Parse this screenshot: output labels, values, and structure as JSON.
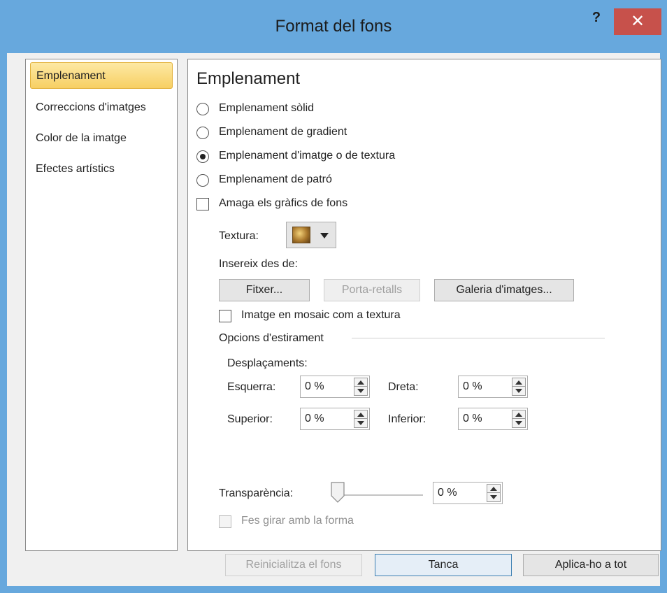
{
  "window": {
    "title": "Format del fons",
    "help_label": "?",
    "close_label": "✕"
  },
  "nav": {
    "items": [
      {
        "label": "Emplenament",
        "selected": true
      },
      {
        "label": "Correccions d'imatges",
        "selected": false
      },
      {
        "label": "Color de la imatge",
        "selected": false
      },
      {
        "label": "Efectes artístics",
        "selected": false
      }
    ]
  },
  "panel": {
    "title": "Emplenament",
    "fill_options": [
      {
        "label": "Emplenament sòlid",
        "checked": false
      },
      {
        "label": "Emplenament de gradient",
        "checked": false
      },
      {
        "label": "Emplenament d'imatge o de textura",
        "checked": true
      },
      {
        "label": "Emplenament de patró",
        "checked": false
      }
    ],
    "hide_background": {
      "label": "Amaga els gràfics de fons",
      "checked": false
    },
    "texture_label": "Textura:",
    "insert_from_label": "Insereix des de:",
    "file_button": "Fitxer...",
    "clipboard_button": "Porta-retalls",
    "gallery_button": "Galeria d'imatges...",
    "tile_checkbox": {
      "label": "Imatge en mosaic com a textura",
      "checked": false
    },
    "stretch_options_label": "Opcions d'estirament",
    "offsets_label": "Desplaçaments:",
    "left_label": "Esquerra:",
    "left_value": "0 %",
    "right_label": "Dreta:",
    "right_value": "0 %",
    "top_label": "Superior:",
    "top_value": "0 %",
    "bottom_label": "Inferior:",
    "bottom_value": "0 %",
    "transparency_label": "Transparència:",
    "transparency_value": "0 %",
    "transparency_level": 0,
    "rotate_checkbox": {
      "label": "Fes girar amb la forma",
      "checked": false,
      "disabled": true
    }
  },
  "footer": {
    "reset_button": "Reinicialitza el fons",
    "close_button": "Tanca",
    "apply_all_button": "Aplica-ho a tot"
  },
  "colors": {
    "title_bar": "#67a8dd",
    "close_button": "#c7514b",
    "selected_nav": "#f7cf63"
  }
}
